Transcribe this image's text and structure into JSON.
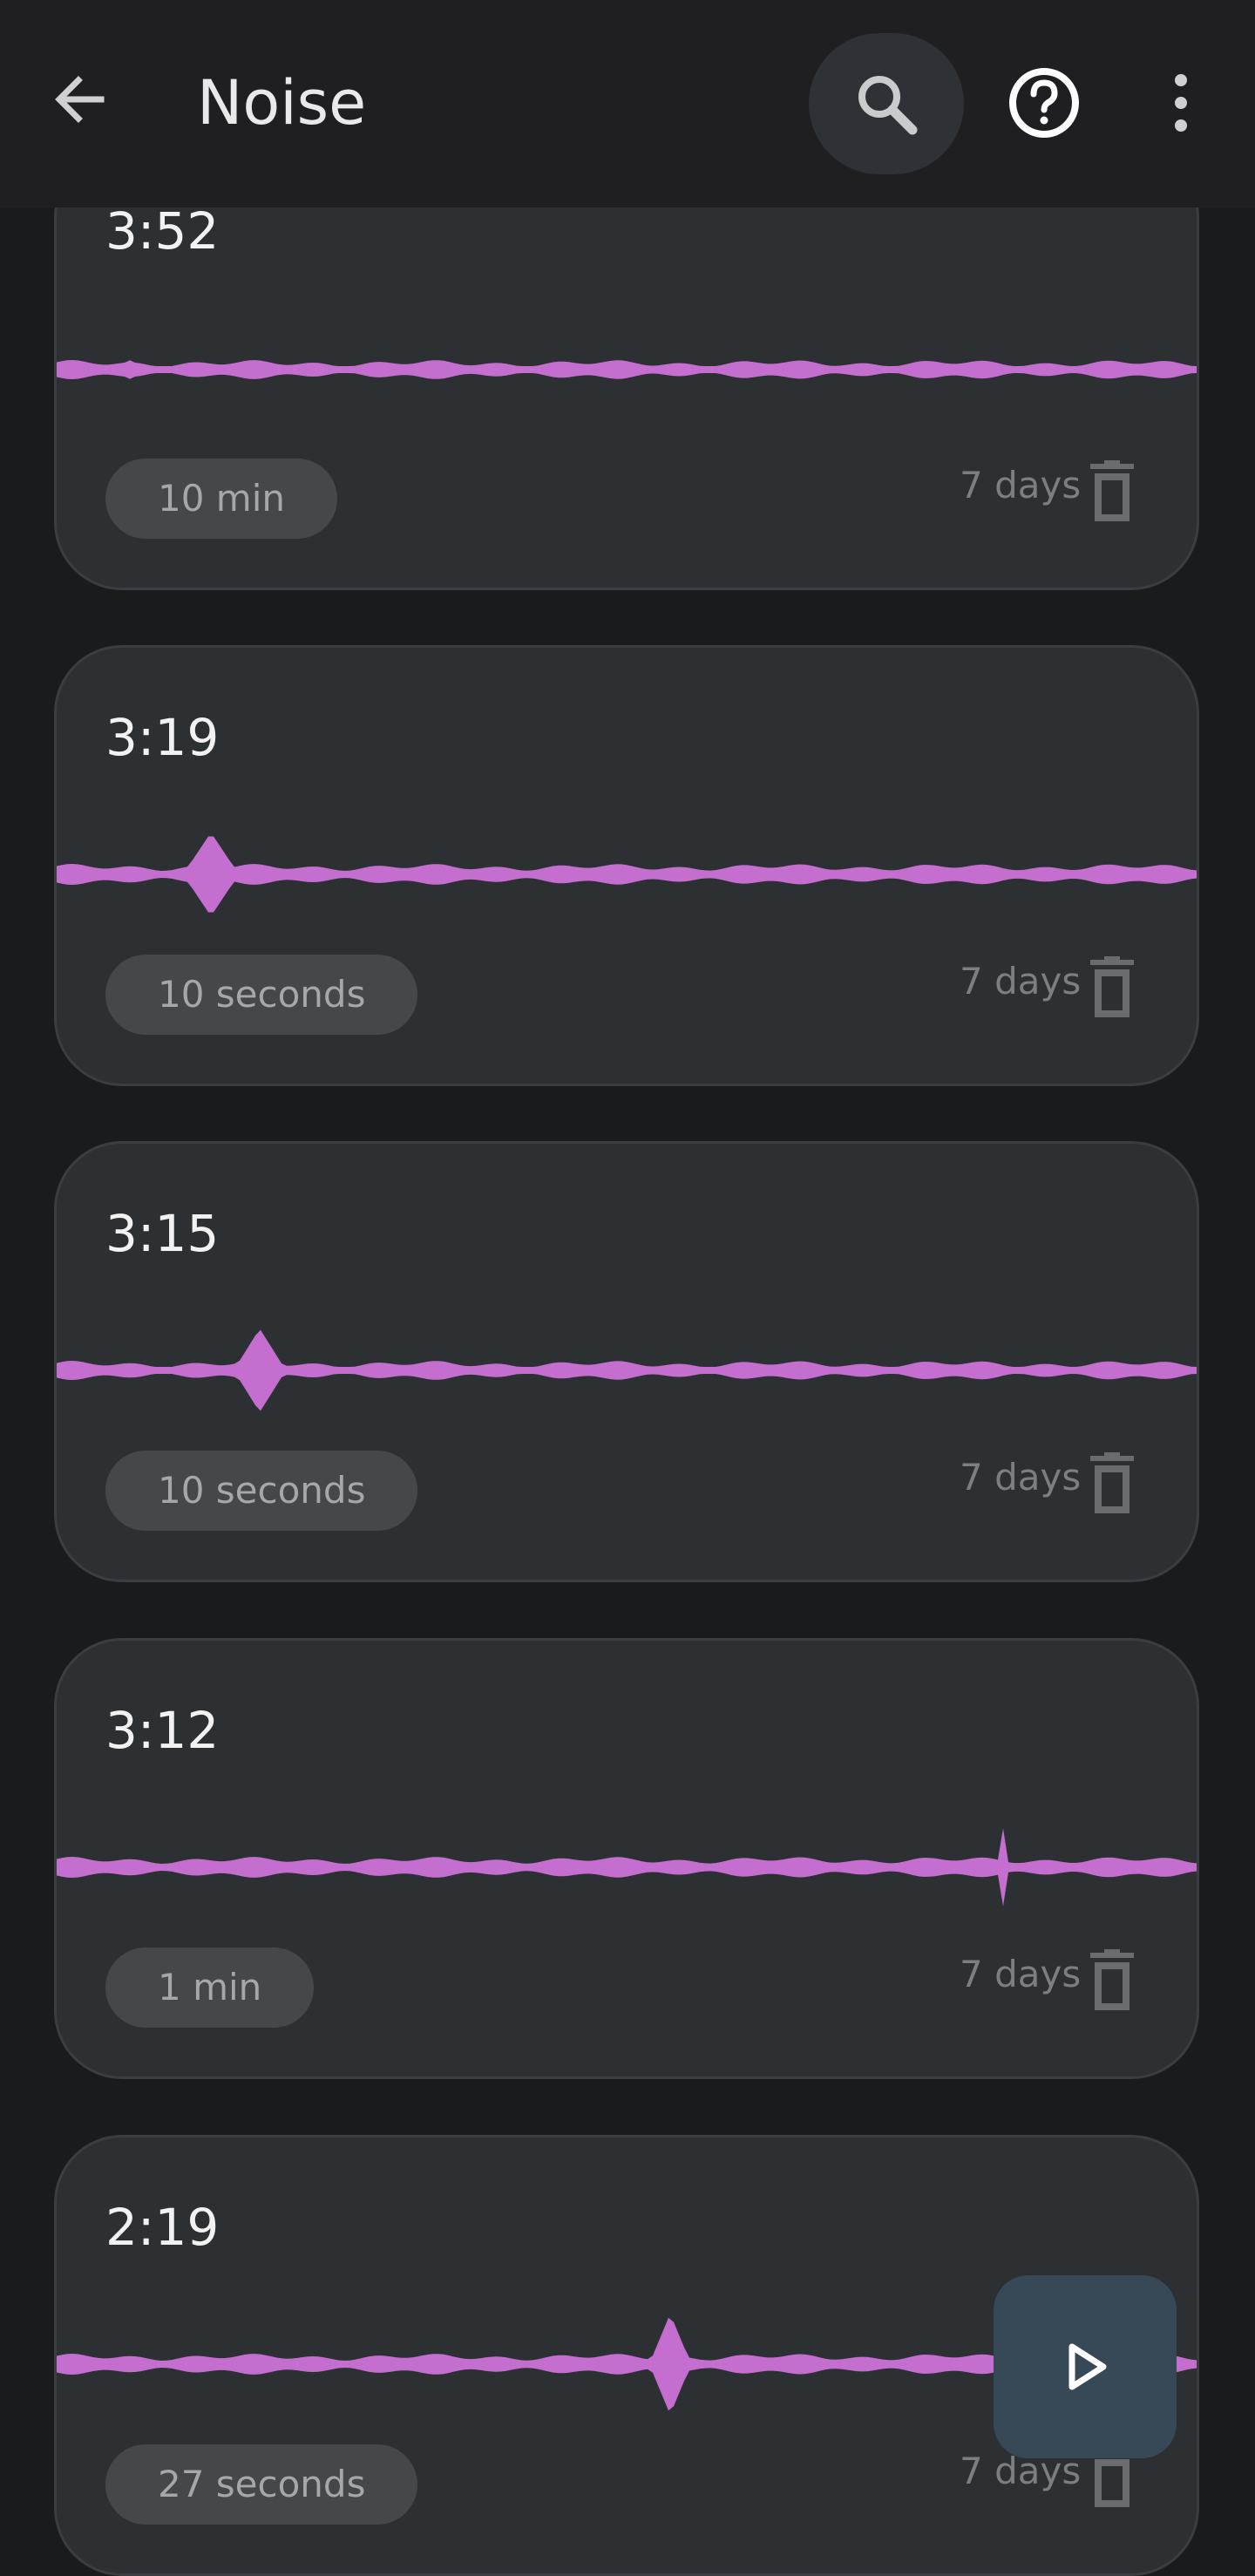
{
  "header": {
    "title": "Noise",
    "back_icon": "arrow-back-icon",
    "search_icon": "search-icon",
    "help_icon": "help-circle-icon",
    "more_icon": "more-vert-icon"
  },
  "recordings": [
    {
      "time": "3:52",
      "duration": "10 min",
      "retention": "7 days"
    },
    {
      "time": "3:19",
      "duration": "10 seconds",
      "retention": "7 days"
    },
    {
      "time": "3:15",
      "duration": "10 seconds",
      "retention": "7 days"
    },
    {
      "time": "3:12",
      "duration": "1 min",
      "retention": "7 days"
    },
    {
      "time": "2:19",
      "duration": "27 seconds",
      "retention": "7 days"
    }
  ],
  "fab": {
    "icon": "play-icon"
  },
  "colors": {
    "background": "#191b1d",
    "card": "#2d3033",
    "waveform": "#c46ecf",
    "chip": "#464749",
    "fab": "#374957"
  }
}
